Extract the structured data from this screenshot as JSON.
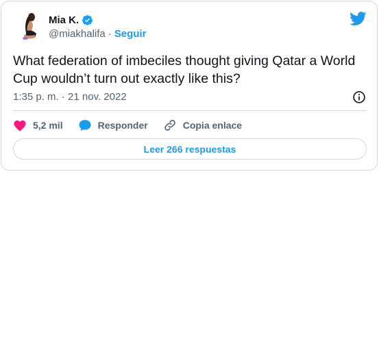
{
  "author": {
    "name": "Mia K.",
    "handle": "@miakhalifa",
    "separator": "·",
    "follow_label": "Seguir",
    "verified": true,
    "avatar": "avatar-photo"
  },
  "tweet": {
    "text": "What federation of imbeciles thought giving Qatar a World Cup wouldn’t turn out exactly like this?",
    "timestamp": "1:35 p. m. · 21 nov. 2022"
  },
  "actions": {
    "like_count": "5,2 mil",
    "reply_label": "Responder",
    "copy_label": "Copia enlace"
  },
  "read_replies_label": "Leer 266 respuestas",
  "icons": {
    "brand": "twitter-bird-icon",
    "verified": "verified-badge-icon",
    "info": "info-icon",
    "like": "heart-icon",
    "reply": "speech-bubble-icon",
    "copy": "link-icon"
  },
  "colors": {
    "accent": "#1d9bf0",
    "like": "#f91880",
    "text_primary": "#0f1419",
    "text_secondary": "#536471",
    "border": "#cfd9de"
  }
}
